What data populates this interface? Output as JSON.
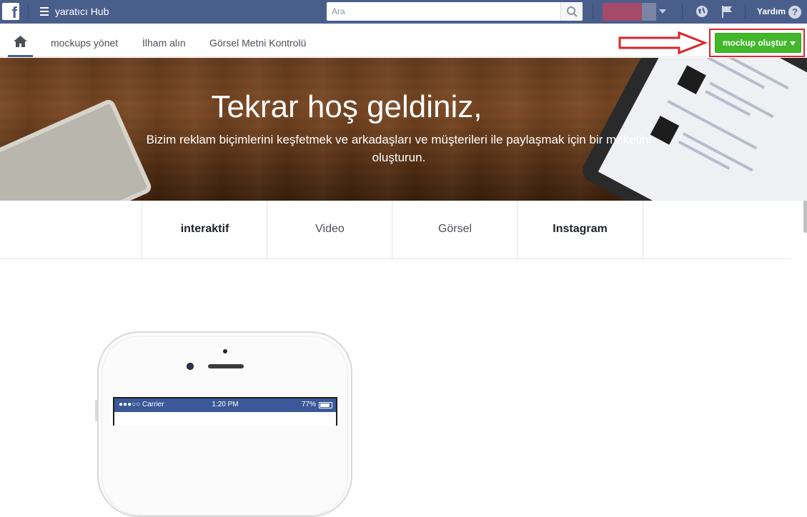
{
  "topbar": {
    "logo_letter": "f",
    "app_title": "yaratıcı Hub",
    "search_placeholder": "Ara",
    "help_label": "Yardım",
    "help_icon": "?",
    "colors": {
      "bar": "#4a5e8c"
    }
  },
  "subnav": {
    "links": [
      "mockups yönet",
      "İlham alın",
      "Görsel Metni Kontrolü"
    ],
    "create_button": "mockup oluştur",
    "accent": "#42b72a",
    "annotation_color": "#d9252b"
  },
  "hero": {
    "title": "Tekrar hoş geldiniz,",
    "subtitle": "Bizim reklam biçimlerini keşfetmek ve arkadaşları ve müşterileri ile paylaşmak için bir maketini oluşturun."
  },
  "format_tabs": [
    {
      "label": "interaktif"
    },
    {
      "label": "Video"
    },
    {
      "label": "Görsel"
    },
    {
      "label": "Instagram"
    }
  ],
  "phone": {
    "carrier": "●●●○○ Carrier",
    "time": "1:20 PM",
    "battery": "77%"
  }
}
